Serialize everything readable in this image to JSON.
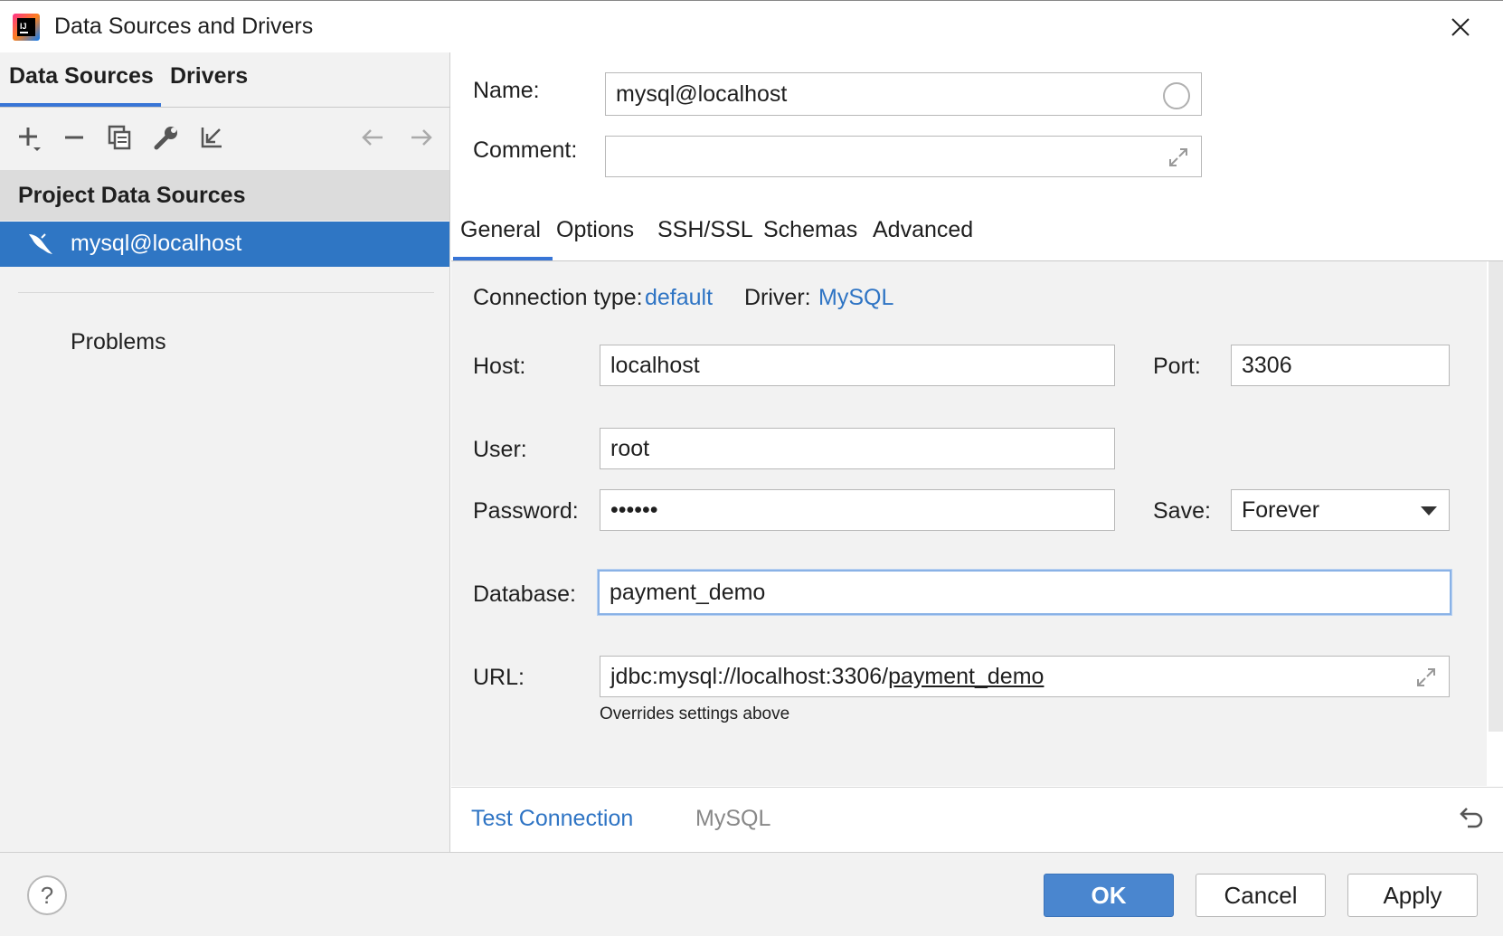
{
  "window": {
    "title": "Data Sources and Drivers"
  },
  "left": {
    "tabs": [
      "Data Sources",
      "Drivers"
    ],
    "toolbar": [
      "add-icon",
      "remove-icon",
      "duplicate-icon",
      "wrench-icon",
      "import-icon",
      "back-arrow-icon",
      "forward-arrow-icon"
    ],
    "section_header": "Project Data Sources",
    "selected_item": "mysql@localhost",
    "problems": "Problems"
  },
  "form": {
    "name_label": "Name:",
    "name_value": "mysql@localhost",
    "comment_label": "Comment:",
    "comment_value": ""
  },
  "tabs": [
    "General",
    "Options",
    "SSH/SSL",
    "Schemas",
    "Advanced"
  ],
  "general": {
    "conn_type_label": "Connection type:",
    "conn_type_value": "default",
    "driver_label": "Driver:",
    "driver_value": "MySQL",
    "host_label": "Host:",
    "host_value": "localhost",
    "port_label": "Port:",
    "port_value": "3306",
    "user_label": "User:",
    "user_value": "root",
    "password_label": "Password:",
    "password_value": "••••••",
    "save_label": "Save:",
    "save_value": "Forever",
    "database_label": "Database:",
    "database_value": "payment_demo",
    "url_label": "URL:",
    "url_prefix": "jdbc:mysql://localhost:3306/",
    "url_db": "payment_demo",
    "url_hint": "Overrides settings above"
  },
  "footer": {
    "test_connection": "Test Connection",
    "driver_name": "MySQL"
  },
  "buttons": {
    "help": "?",
    "ok": "OK",
    "cancel": "Cancel",
    "apply": "Apply"
  },
  "colors": {
    "accent": "#3875d6",
    "selection": "#2f76c4",
    "link": "#2e74c4",
    "ok_button": "#4a86cf"
  }
}
